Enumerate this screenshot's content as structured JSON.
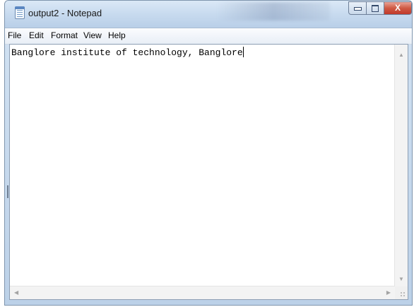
{
  "window": {
    "title": "output2 - Notepad",
    "icons": {
      "app": "notepad-icon",
      "minimize": "minimize-icon",
      "maximize": "maximize-icon",
      "close": "close-icon"
    },
    "close_glyph": "X"
  },
  "menu": {
    "items": [
      {
        "label": "File"
      },
      {
        "label": "Edit"
      },
      {
        "label": "Format"
      },
      {
        "label": "View"
      },
      {
        "label": "Help"
      }
    ]
  },
  "editor": {
    "content": "Banglore institute of technology, Banglore"
  },
  "scrollbars": {
    "up_arrow": "▲",
    "down_arrow": "▼",
    "left_arrow": "◀",
    "right_arrow": "▶"
  },
  "colors": {
    "title_bar": "#c6d9ee",
    "close_button": "#cf5a43",
    "editor_background": "#ffffff"
  }
}
